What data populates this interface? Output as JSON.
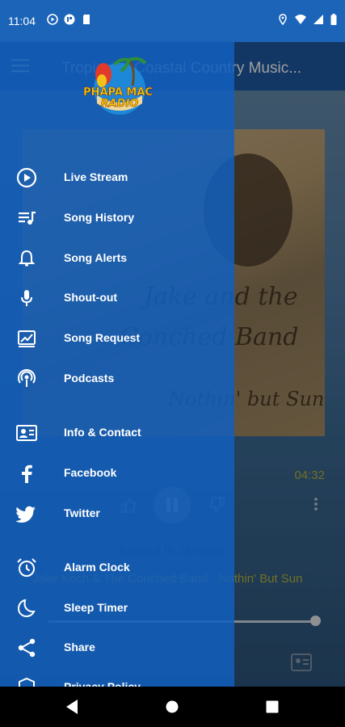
{
  "status_bar": {
    "time": "11:04"
  },
  "app": {
    "title": "Tropical & Coastal Country Music...",
    "elapsed_time": "04:32",
    "song_title": "Busted In Jamaica",
    "song_artist": "Jake Koch & The Conched Band - Nothin' But Sun",
    "album_art_text": [
      "Jake and the",
      "Conched Band",
      "Nothin' but Sun"
    ]
  },
  "drawer": {
    "logo_text": [
      "PHAPA MAC",
      "RADIO"
    ],
    "items": [
      {
        "label": "Live Stream",
        "icon": "play-circle-icon"
      },
      {
        "label": "Song History",
        "icon": "playlist-icon"
      },
      {
        "label": "Song Alerts",
        "icon": "bell-icon"
      },
      {
        "label": "Shout-out",
        "icon": "microphone-icon"
      },
      {
        "label": "Song Request",
        "icon": "request-icon"
      },
      {
        "label": "Podcasts",
        "icon": "podcast-icon"
      },
      {
        "label": "Info & Contact",
        "icon": "contact-card-icon"
      },
      {
        "label": "Facebook",
        "icon": "facebook-icon"
      },
      {
        "label": "Twitter",
        "icon": "twitter-icon"
      },
      {
        "label": "Alarm Clock",
        "icon": "alarm-clock-icon"
      },
      {
        "label": "Sleep Timer",
        "icon": "moon-icon"
      },
      {
        "label": "Share",
        "icon": "share-icon"
      },
      {
        "label": "Privacy Policy",
        "icon": "shield-icon"
      }
    ]
  },
  "colors": {
    "drawer": "#1560be",
    "header": "#1d5aa3",
    "accent": "#b6b63c"
  }
}
